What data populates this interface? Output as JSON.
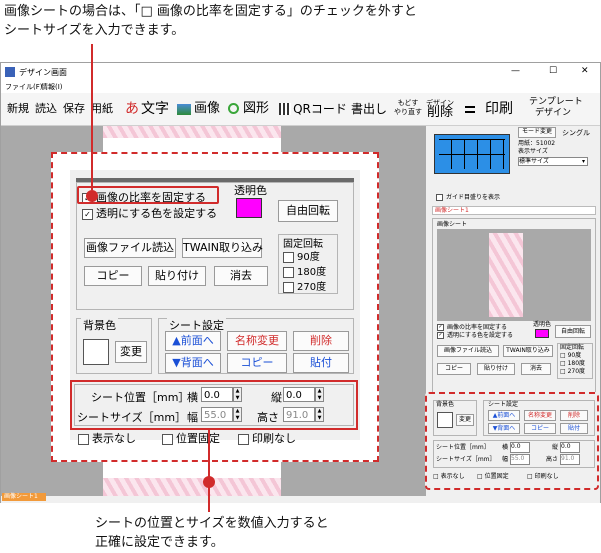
{
  "captions": {
    "top_line1": "画像シートの場合は、「□ 画像の比率を固定する」のチェックを外すと",
    "top_line2": "シートサイズを入力できます。",
    "bottom_line1": "シートの位置とサイズを数値入力すると",
    "bottom_line2": "正確に設定できます。"
  },
  "window": {
    "title": "デザイン画面",
    "menu": [
      "ファイル(F)",
      "情報(I)"
    ],
    "minimize": "—",
    "maximize": "☐",
    "close": "✕"
  },
  "toolbar": {
    "new": "新規",
    "load": "読込",
    "save": "保存",
    "paper": "用紙",
    "text_icon": "あ",
    "text": "文字",
    "image": "画像",
    "shape": "図形",
    "qr": "QRコード",
    "export": "書出し",
    "undo_top": "もどす",
    "undo_bottom": "やり直す",
    "delete_top": "デザイン",
    "delete": "削除",
    "print": "印刷",
    "template_top": "テンプレート",
    "template_bottom": "デザイン"
  },
  "right_panel": {
    "mode_change": "モード変更",
    "mode": "シングル",
    "paper_label": "用紙：51002",
    "display_size_label": "表示サイズ",
    "display_size_value": "標準サイズ",
    "guide_checkbox": "ガイド目盛りを表示",
    "sheet_tab": "画像シート1",
    "section_label": "画像シート"
  },
  "sheet_settings": {
    "keep_ratio": "画像の比率を固定する",
    "transparent_color_setting": "透明にする色を設定する",
    "transparent_color": "透明色",
    "transparent_color_value": "#ff00ff",
    "free_rotate": "自由回転",
    "load_image_file": "画像ファイル読込",
    "twain_load": "TWAIN取り込み",
    "fixed_rotate": "固定回転",
    "rot90": "90度",
    "rot180": "180度",
    "rot270": "270度",
    "copy": "コピー",
    "paste": "貼り付け",
    "erase": "消去",
    "bg_color": "背景色",
    "change": "変更",
    "sheet_setting": "シート設定",
    "front": "▲前面へ",
    "back": "▼背面へ",
    "rename": "名称変更",
    "delete": "削除",
    "sheet_copy": "コピー",
    "sheet_paste": "貼付",
    "position_label": "シート位置［mm］",
    "horizontal": "横",
    "vertical": "縦",
    "x_value": "0.0",
    "y_value": "0.0",
    "size_label": "シートサイズ［mm］",
    "width_label": "幅",
    "height_label": "高さ",
    "width_value": "55.0",
    "height_value": "91.0",
    "hide": "表示なし",
    "fix_position": "位置固定",
    "no_print": "印刷なし"
  },
  "status": {
    "tab": "画像シート1"
  },
  "colors": {
    "accent_red": "#d12b2b",
    "magenta": "#ff00ff",
    "blue_button_text": "#1a4fd6",
    "red_button_text": "#d12b2b",
    "canvas_gray": "#a9a9a9",
    "tab_orange": "#f29a3a"
  }
}
